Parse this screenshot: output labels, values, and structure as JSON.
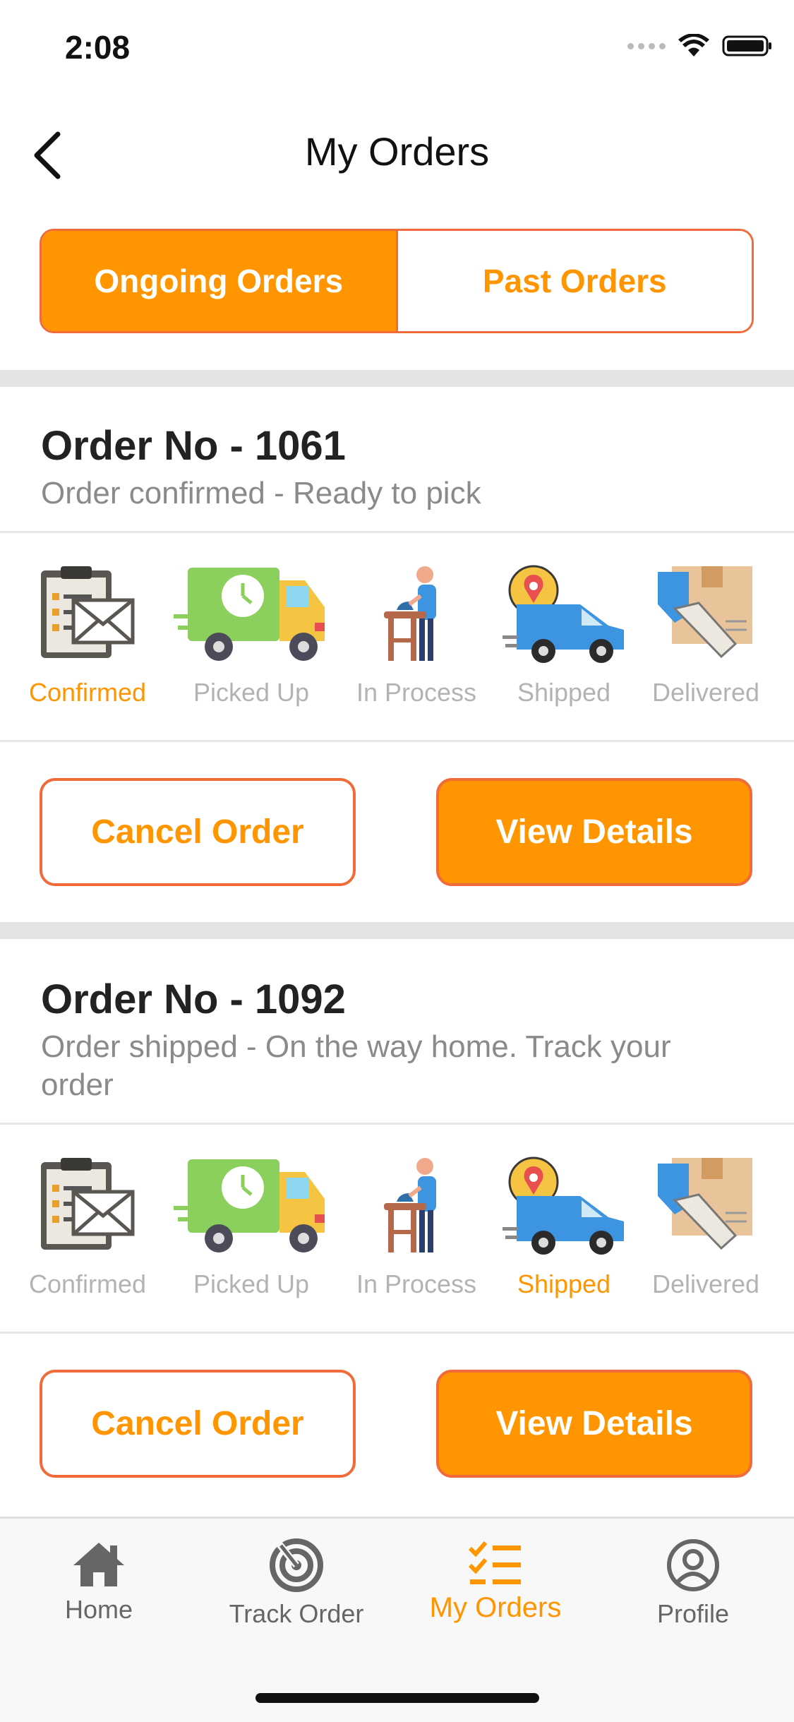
{
  "status_bar": {
    "time": "2:08"
  },
  "nav": {
    "title": "My Orders"
  },
  "tabs": {
    "ongoing": "Ongoing Orders",
    "past": "Past Orders"
  },
  "orders": [
    {
      "title": "Order No - 1061",
      "status_text": "Order confirmed - Ready to pick",
      "active_step": "Confirmed",
      "steps": [
        "Confirmed",
        "Picked Up",
        "In Process",
        "Shipped",
        "Delivered"
      ],
      "cancel_label": "Cancel Order",
      "details_label": "View Details"
    },
    {
      "title": "Order No - 1092",
      "status_text": "Order shipped - On the way home. Track your order",
      "active_step": "Shipped",
      "steps": [
        "Confirmed",
        "Picked Up",
        "In Process",
        "Shipped",
        "Delivered"
      ],
      "cancel_label": "Cancel Order",
      "details_label": "View Details"
    }
  ],
  "bottom_tabs": [
    {
      "label": "Home",
      "icon": "home-icon"
    },
    {
      "label": "Track Order",
      "icon": "track-order-icon"
    },
    {
      "label": "My Orders",
      "icon": "my-orders-icon",
      "active": true
    },
    {
      "label": "Profile",
      "icon": "profile-icon"
    }
  ],
  "colors": {
    "accent": "#ff9500",
    "border": "#f16b3a",
    "muted": "#b3b3b3"
  }
}
